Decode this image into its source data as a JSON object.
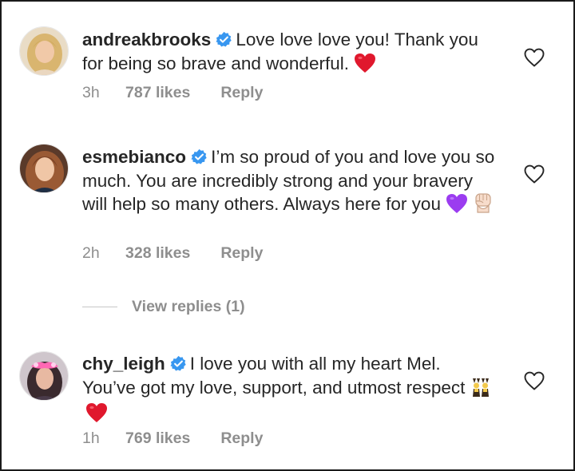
{
  "comments": [
    {
      "username": "andreakbrooks",
      "text": "Love love love you! Thank you for being so brave and wonderful.",
      "emojis": [
        "red-heart"
      ],
      "time": "3h",
      "likes": "787 likes",
      "reply": "Reply"
    },
    {
      "username": "esmebianco",
      "text": "I’m so proud of you and love you so much. You are incredibly strong and your bravery will help so many others. Always here for you",
      "emojis": [
        "purple-heart",
        "raised-fist"
      ],
      "time": "2h",
      "likes": "328 likes",
      "reply": "Reply"
    },
    {
      "username": "chy_leigh",
      "text": "I love you with all my heart Mel. You’ve got my love, support, and utmost respect",
      "emojis": [
        "people-with-bunny-ears",
        "red-heart"
      ],
      "time": "1h",
      "likes": "769 likes",
      "reply": "Reply"
    }
  ],
  "view_replies": "View replies (1)",
  "colors": {
    "text": "#262626",
    "secondary": "#8e8e8e",
    "verified": "#3897f0",
    "heart": "#e0182d",
    "purple_heart": "#9b3cf0"
  }
}
